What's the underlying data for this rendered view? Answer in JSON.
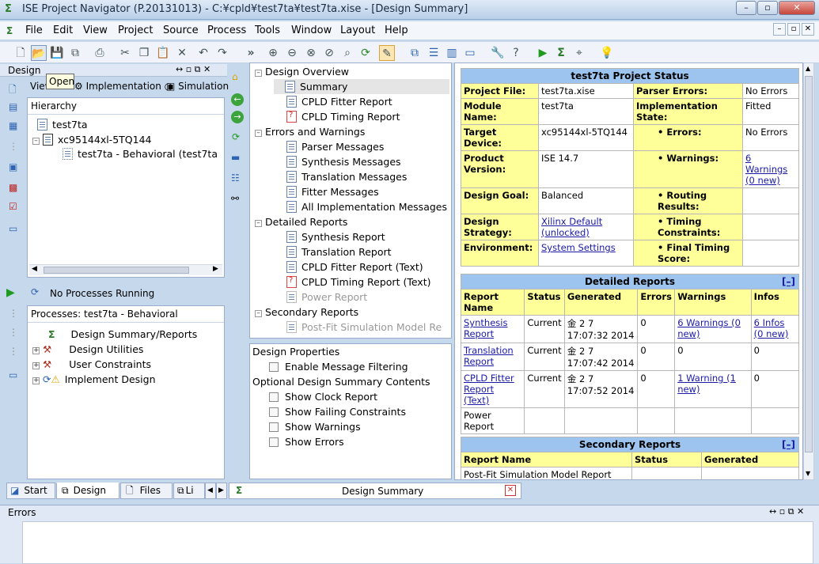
{
  "window": {
    "title": "ISE Project Navigator (P.20131013) - C:¥cpld¥test7ta¥test7ta.xise - [Design Summary]"
  },
  "menu": [
    "File",
    "Edit",
    "View",
    "Project",
    "Source",
    "Process",
    "Tools",
    "Window",
    "Layout",
    "Help"
  ],
  "tooltip": "Open",
  "design_panel": {
    "title": "Design",
    "view_label": "View:",
    "view_impl": "Implementation",
    "view_sim": "Simulation",
    "hierarchy_label": "Hierarchy",
    "tree": [
      "test7ta",
      "xc95144xl-5TQ144",
      "test7ta - Behavioral (test7ta"
    ]
  },
  "process_panel": {
    "status": "No Processes Running",
    "title": "Processes: test7ta - Behavioral",
    "items": [
      "Design Summary/Reports",
      "Design Utilities",
      "User Constraints",
      "Implement Design"
    ]
  },
  "bottom_tabs": [
    "Start",
    "Design",
    "Files",
    "Li"
  ],
  "summary_tree": {
    "groups": [
      {
        "label": "Design Overview",
        "items": [
          "Summary",
          "CPLD Fitter Report",
          "CPLD Timing Report"
        ]
      },
      {
        "label": "Errors and Warnings",
        "items": [
          "Parser Messages",
          "Synthesis Messages",
          "Translation Messages",
          "Fitter Messages",
          "All Implementation Messages"
        ]
      },
      {
        "label": "Detailed Reports",
        "items": [
          "Synthesis Report",
          "Translation Report",
          "CPLD Fitter Report (Text)",
          "CPLD Timing Report (Text)",
          "Power Report"
        ]
      },
      {
        "label": "Secondary Reports",
        "items": [
          "Post-Fit Simulation Model Re"
        ]
      }
    ]
  },
  "design_props": {
    "title": "Design Properties",
    "enable_filter": "Enable Message Filtering",
    "optional_title": "Optional Design Summary Contents",
    "options": [
      "Show Clock Report",
      "Show Failing Constraints",
      "Show Warnings",
      "Show Errors"
    ]
  },
  "status_table": {
    "title": "test7ta Project Status",
    "rows": [
      [
        "Project File:",
        "test7ta.xise",
        "Parser Errors:",
        "No Errors"
      ],
      [
        "Module Name:",
        "test7ta",
        "Implementation State:",
        "Fitted"
      ],
      [
        "Target Device:",
        "xc95144xl-5TQ144",
        "• Errors:",
        "No Errors"
      ],
      [
        "Product Version:",
        "ISE 14.7",
        "• Warnings:",
        "6 Warnings (0 new)"
      ],
      [
        "Design Goal:",
        "Balanced",
        "• Routing Results:",
        ""
      ],
      [
        "Design Strategy:",
        "Xilinx Default (unlocked)",
        "• Timing Constraints:",
        ""
      ],
      [
        "Environment:",
        "System Settings",
        "• Final Timing Score:",
        ""
      ]
    ]
  },
  "detailed_reports": {
    "title": "Detailed Reports",
    "collapse": "[–]",
    "headers": [
      "Report Name",
      "Status",
      "Generated",
      "Errors",
      "Warnings",
      "Infos"
    ],
    "rows": [
      [
        "Synthesis Report",
        "Current",
        "金 2 7 17:07:32 2014",
        "0",
        "6 Warnings (0 new)",
        "6 Infos (0 new)"
      ],
      [
        "Translation Report",
        "Current",
        "金 2 7 17:07:42 2014",
        "0",
        "0",
        "0"
      ],
      [
        "CPLD Fitter Report (Text)",
        "Current",
        "金 2 7 17:07:52 2014",
        "0",
        "1 Warning (1 new)",
        "0"
      ],
      [
        "Power Report",
        "",
        "",
        "",
        "",
        ""
      ]
    ]
  },
  "secondary_reports": {
    "title": "Secondary Reports",
    "collapse": "[–]",
    "headers": [
      "Report Name",
      "Status",
      "Generated"
    ],
    "rows": [
      [
        "Post-Fit Simulation Model Report",
        "",
        ""
      ]
    ]
  },
  "doc_tab": "Design Summary",
  "errors_panel": {
    "title": "Errors"
  }
}
